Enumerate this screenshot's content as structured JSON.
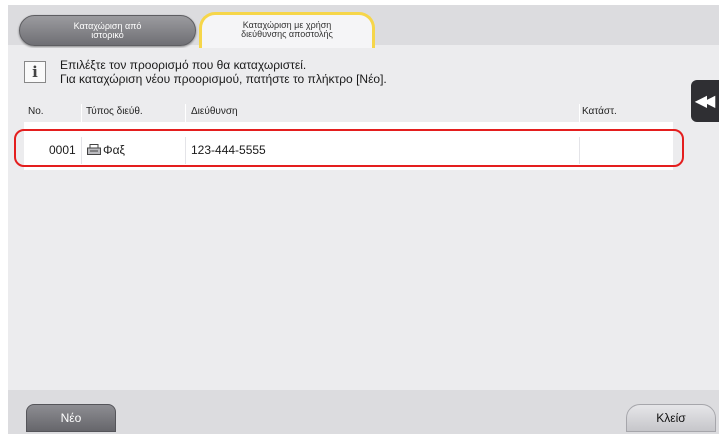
{
  "tabs": [
    {
      "label_line1": "Καταχώριση από",
      "label_line2": "ιστορικό"
    },
    {
      "label_line1": "Καταχώριση με χρήση",
      "label_line2": "διεύθυνσης αποστολής"
    }
  ],
  "info": {
    "icon": "info-icon",
    "line1": "Επιλέξτε τον προορισμό που θα καταχωριστεί.",
    "line2": "Για καταχώριση νέου προορισμού, πατήστε το πλήκτρο [Νέο]."
  },
  "table": {
    "headers": {
      "no": "No.",
      "type": "Τύπος διεύθ.",
      "address": "Διεύθυνση",
      "status": "Κατάστ."
    },
    "rows": [
      {
        "no": "0001",
        "type": "Φαξ",
        "type_icon": "fax-icon",
        "address": "123-444-5555",
        "status": ""
      }
    ]
  },
  "side_button": {
    "icon": "double-chevron-left-icon",
    "glyph": "◀◀"
  },
  "buttons": {
    "new": "Νέο",
    "close": "Κλείσ"
  },
  "colors": {
    "highlight": "#e41e1e",
    "active_tab_border": "#f6d64a"
  }
}
